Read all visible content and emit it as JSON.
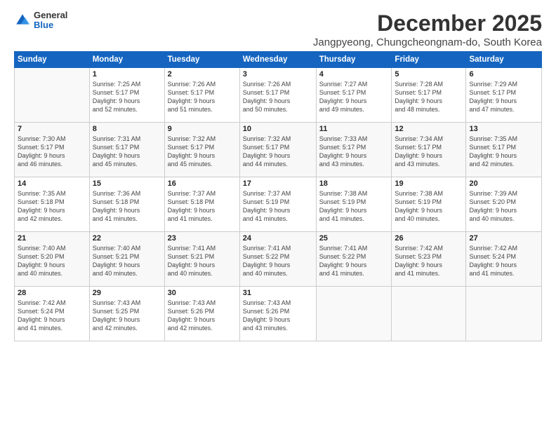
{
  "logo": {
    "general": "General",
    "blue": "Blue"
  },
  "header": {
    "month": "December 2025",
    "location": "Jangpyeong, Chungcheongnam-do, South Korea"
  },
  "weekdays": [
    "Sunday",
    "Monday",
    "Tuesday",
    "Wednesday",
    "Thursday",
    "Friday",
    "Saturday"
  ],
  "weeks": [
    [
      {
        "day": "",
        "info": ""
      },
      {
        "day": "1",
        "info": "Sunrise: 7:25 AM\nSunset: 5:17 PM\nDaylight: 9 hours\nand 52 minutes."
      },
      {
        "day": "2",
        "info": "Sunrise: 7:26 AM\nSunset: 5:17 PM\nDaylight: 9 hours\nand 51 minutes."
      },
      {
        "day": "3",
        "info": "Sunrise: 7:26 AM\nSunset: 5:17 PM\nDaylight: 9 hours\nand 50 minutes."
      },
      {
        "day": "4",
        "info": "Sunrise: 7:27 AM\nSunset: 5:17 PM\nDaylight: 9 hours\nand 49 minutes."
      },
      {
        "day": "5",
        "info": "Sunrise: 7:28 AM\nSunset: 5:17 PM\nDaylight: 9 hours\nand 48 minutes."
      },
      {
        "day": "6",
        "info": "Sunrise: 7:29 AM\nSunset: 5:17 PM\nDaylight: 9 hours\nand 47 minutes."
      }
    ],
    [
      {
        "day": "7",
        "info": "Sunrise: 7:30 AM\nSunset: 5:17 PM\nDaylight: 9 hours\nand 46 minutes."
      },
      {
        "day": "8",
        "info": "Sunrise: 7:31 AM\nSunset: 5:17 PM\nDaylight: 9 hours\nand 45 minutes."
      },
      {
        "day": "9",
        "info": "Sunrise: 7:32 AM\nSunset: 5:17 PM\nDaylight: 9 hours\nand 45 minutes."
      },
      {
        "day": "10",
        "info": "Sunrise: 7:32 AM\nSunset: 5:17 PM\nDaylight: 9 hours\nand 44 minutes."
      },
      {
        "day": "11",
        "info": "Sunrise: 7:33 AM\nSunset: 5:17 PM\nDaylight: 9 hours\nand 43 minutes."
      },
      {
        "day": "12",
        "info": "Sunrise: 7:34 AM\nSunset: 5:17 PM\nDaylight: 9 hours\nand 43 minutes."
      },
      {
        "day": "13",
        "info": "Sunrise: 7:35 AM\nSunset: 5:17 PM\nDaylight: 9 hours\nand 42 minutes."
      }
    ],
    [
      {
        "day": "14",
        "info": "Sunrise: 7:35 AM\nSunset: 5:18 PM\nDaylight: 9 hours\nand 42 minutes."
      },
      {
        "day": "15",
        "info": "Sunrise: 7:36 AM\nSunset: 5:18 PM\nDaylight: 9 hours\nand 41 minutes."
      },
      {
        "day": "16",
        "info": "Sunrise: 7:37 AM\nSunset: 5:18 PM\nDaylight: 9 hours\nand 41 minutes."
      },
      {
        "day": "17",
        "info": "Sunrise: 7:37 AM\nSunset: 5:19 PM\nDaylight: 9 hours\nand 41 minutes."
      },
      {
        "day": "18",
        "info": "Sunrise: 7:38 AM\nSunset: 5:19 PM\nDaylight: 9 hours\nand 41 minutes."
      },
      {
        "day": "19",
        "info": "Sunrise: 7:38 AM\nSunset: 5:19 PM\nDaylight: 9 hours\nand 40 minutes."
      },
      {
        "day": "20",
        "info": "Sunrise: 7:39 AM\nSunset: 5:20 PM\nDaylight: 9 hours\nand 40 minutes."
      }
    ],
    [
      {
        "day": "21",
        "info": "Sunrise: 7:40 AM\nSunset: 5:20 PM\nDaylight: 9 hours\nand 40 minutes."
      },
      {
        "day": "22",
        "info": "Sunrise: 7:40 AM\nSunset: 5:21 PM\nDaylight: 9 hours\nand 40 minutes."
      },
      {
        "day": "23",
        "info": "Sunrise: 7:41 AM\nSunset: 5:21 PM\nDaylight: 9 hours\nand 40 minutes."
      },
      {
        "day": "24",
        "info": "Sunrise: 7:41 AM\nSunset: 5:22 PM\nDaylight: 9 hours\nand 40 minutes."
      },
      {
        "day": "25",
        "info": "Sunrise: 7:41 AM\nSunset: 5:22 PM\nDaylight: 9 hours\nand 41 minutes."
      },
      {
        "day": "26",
        "info": "Sunrise: 7:42 AM\nSunset: 5:23 PM\nDaylight: 9 hours\nand 41 minutes."
      },
      {
        "day": "27",
        "info": "Sunrise: 7:42 AM\nSunset: 5:24 PM\nDaylight: 9 hours\nand 41 minutes."
      }
    ],
    [
      {
        "day": "28",
        "info": "Sunrise: 7:42 AM\nSunset: 5:24 PM\nDaylight: 9 hours\nand 41 minutes."
      },
      {
        "day": "29",
        "info": "Sunrise: 7:43 AM\nSunset: 5:25 PM\nDaylight: 9 hours\nand 42 minutes."
      },
      {
        "day": "30",
        "info": "Sunrise: 7:43 AM\nSunset: 5:26 PM\nDaylight: 9 hours\nand 42 minutes."
      },
      {
        "day": "31",
        "info": "Sunrise: 7:43 AM\nSunset: 5:26 PM\nDaylight: 9 hours\nand 43 minutes."
      },
      {
        "day": "",
        "info": ""
      },
      {
        "day": "",
        "info": ""
      },
      {
        "day": "",
        "info": ""
      }
    ]
  ]
}
